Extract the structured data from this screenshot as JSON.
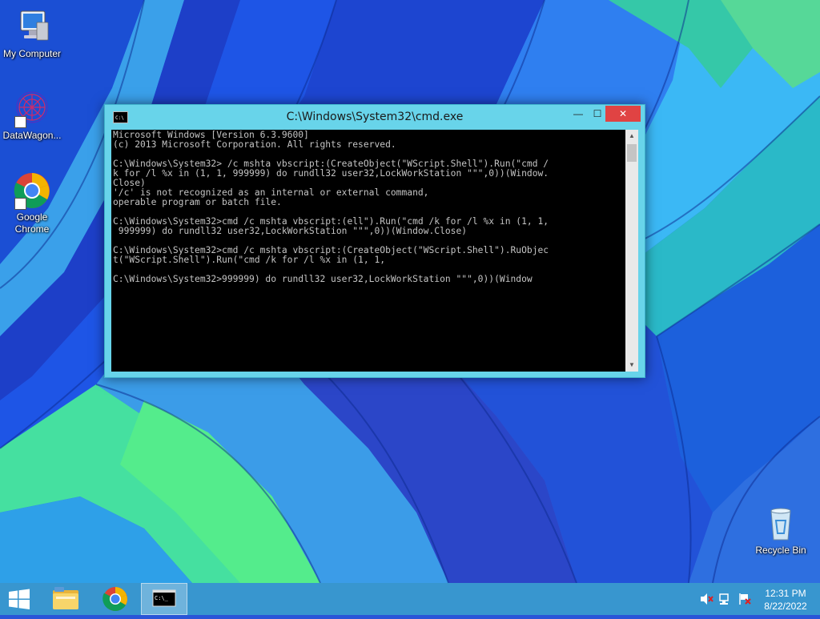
{
  "desktop": {
    "icons": [
      {
        "label": "My Computer"
      },
      {
        "label": "DataWagon..."
      },
      {
        "label": "Google Chrome"
      },
      {
        "label": "Recycle Bin"
      }
    ]
  },
  "window": {
    "title": "C:\\Windows\\System32\\cmd.exe",
    "buttons": {
      "minimize": "—",
      "maximize": "☐",
      "close": "✕"
    },
    "console_lines": [
      "Microsoft Windows [Version 6.3.9600]",
      "(c) 2013 Microsoft Corporation. All rights reserved.",
      "",
      "C:\\Windows\\System32> /c mshta vbscript:(CreateObject(\"WScript.Shell\").Run(\"cmd /",
      "k for /l %x in (1, 1, 999999) do rundll32 user32,LockWorkStation \"\"\",0))(Window.",
      "Close)",
      "'/c' is not recognized as an internal or external command,",
      "operable program or batch file.",
      "",
      "C:\\Windows\\System32>cmd /c mshta vbscript:(ell\").Run(\"cmd /k for /l %x in (1, 1,",
      " 999999) do rundll32 user32,LockWorkStation \"\"\",0))(Window.Close)",
      "",
      "C:\\Windows\\System32>cmd /c mshta vbscript:(CreateObject(\"WScript.Shell\").RuObjec",
      "t(\"WScript.Shell\").Run(\"cmd /k for /l %x in (1, 1,",
      "",
      "C:\\Windows\\System32>999999) do rundll32 user32,LockWorkStation \"\"\",0))(Window"
    ]
  },
  "taskbar": {
    "clock_time": "12:31 PM",
    "clock_date": "8/22/2022"
  },
  "colors": {
    "console_bg": "#000000",
    "console_text": "#c4c4c4",
    "window_frame": "#68d4ea",
    "close_button": "#e04343",
    "taskbar": "#3caac8"
  }
}
